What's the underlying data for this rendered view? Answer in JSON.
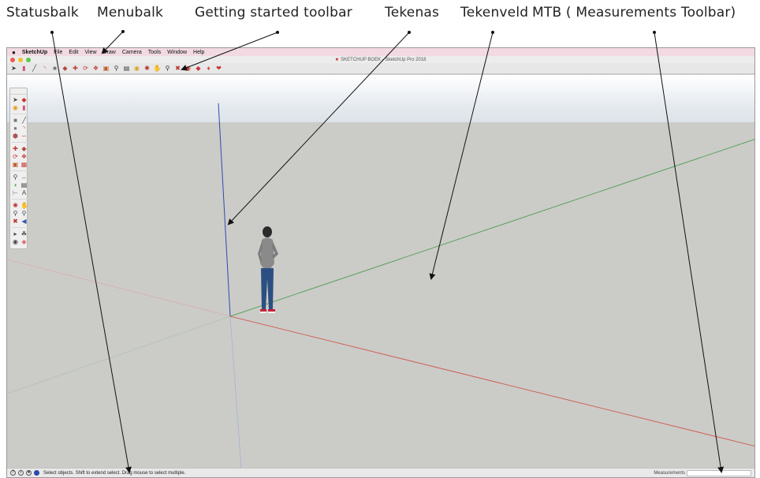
{
  "annotations": {
    "statusbalk": "Statusbalk",
    "menubalk": "Menubalk",
    "getting_started": "Getting started toolbar",
    "tekenas": "Tekenas",
    "tekenveld": "Tekenveld",
    "mtb": "MTB ( Measurements Toolbar)"
  },
  "menubar": {
    "apple_icon": "",
    "app_name": "SketchUp",
    "items": [
      "File",
      "Edit",
      "View",
      "Draw",
      "Camera",
      "Tools",
      "Window",
      "Help"
    ]
  },
  "window": {
    "title": "SKETCHUP BOEK - SketchUp Pro 2018"
  },
  "toolbar": {
    "icons": [
      "select-icon",
      "eraser-icon",
      "line-icon",
      "arc-icon",
      "shape-icon",
      "push-pull-icon",
      "move-icon",
      "rotate-icon",
      "follow-me-icon",
      "scale-icon",
      "tape-measure-icon",
      "text-icon",
      "paint-bucket-icon",
      "orbit-icon",
      "pan-icon",
      "zoom-icon",
      "zoom-extents-icon",
      "warehouse-icon",
      "extension-icon",
      "layout-icon",
      "styles-icon"
    ]
  },
  "statusbar": {
    "message": "Select objects. Shift to extend select. Drag mouse to select multiple.",
    "measurements_label": "Measurements",
    "measurements_value": ""
  },
  "colors": {
    "x_axis": "#d04a3a",
    "y_axis": "#3f9a3f",
    "z_axis": "#2f4bb0",
    "ground": "#cbcbc8",
    "menubar": "#f2d9e2"
  }
}
